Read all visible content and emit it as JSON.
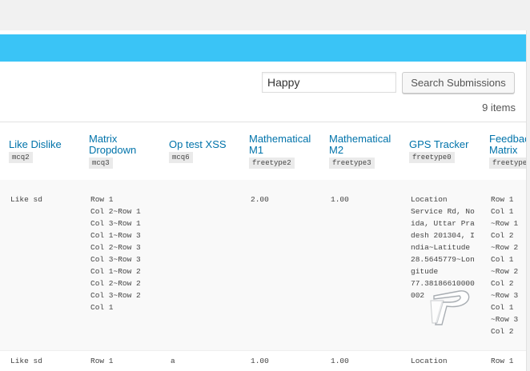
{
  "search": {
    "value": "Happy",
    "button_label": "Search Submissions"
  },
  "items_count": "9 items",
  "columns": [
    {
      "label": "Like Dislike",
      "code": "mcq2"
    },
    {
      "label": "Matrix Dropdown",
      "code": "mcq3"
    },
    {
      "label": "Op test XSS",
      "code": "mcq6"
    },
    {
      "label": "Mathematical M1",
      "code": "freetype2"
    },
    {
      "label": "Mathematical M2",
      "code": "freetype3"
    },
    {
      "label": "GPS Tracker",
      "code": "freetype0"
    },
    {
      "label": "Feedback Matrix",
      "code": "freetype"
    }
  ],
  "rows": [
    {
      "like_dislike": "Like sd",
      "matrix_dropdown": "Row 1\nCol 2~Row 1\nCol 3~Row 1\nCol 1~Row 3\nCol 2~Row 3\nCol 3~Row 3\nCol 1~Row 2\nCol 2~Row 2\nCol 3~Row 2\nCol 1",
      "op_test": "",
      "m1": "2.00",
      "m2": "1.00",
      "gps": "Location\nService Rd, No\nida, Uttar Pra\ndesh 201304, I\nndia~Latitude\n28.5645779~Lon\ngitude\n77.38186610000\n002",
      "feedback": "Row 1\nCol 1\n~Row 1\nCol 2\n~Row 2\nCol 1\n~Row 2\nCol 2\n~Row 3\nCol 1\n~Row 3\nCol 2"
    },
    {
      "like_dislike": "Like sd",
      "matrix_dropdown": "Row 1",
      "op_test": "a",
      "m1": "1.00",
      "m2": "1.00",
      "gps": "Location",
      "feedback": "Row 1"
    }
  ],
  "colors": {
    "accent_bar": "#3ac4f6",
    "link": "#0073aa"
  },
  "icons": {
    "logo": "logo-icon"
  }
}
